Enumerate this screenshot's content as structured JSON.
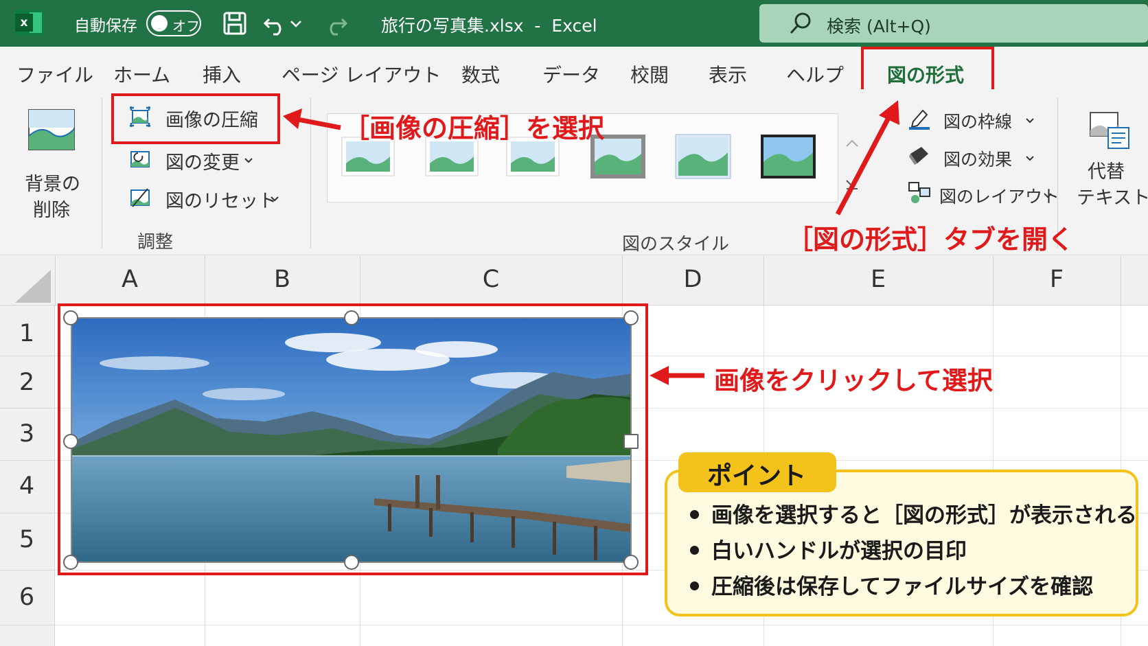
{
  "titlebar": {
    "autosave_label": "自動保存",
    "autosave_state": "オフ",
    "doc_title": "旅行の写真集.xlsx  -  Excel",
    "search_text": "検索 (Alt+Q)"
  },
  "tabs": [
    {
      "label": "ファイル"
    },
    {
      "label": "ホーム"
    },
    {
      "label": "挿入"
    },
    {
      "label": "ページ レイアウト"
    },
    {
      "label": "数式"
    },
    {
      "label": "データ"
    },
    {
      "label": "校閲"
    },
    {
      "label": "表示"
    },
    {
      "label": "ヘルプ"
    },
    {
      "label": "図の形式",
      "active": true
    }
  ],
  "ribbon": {
    "remove_bg_line1": "背景の",
    "remove_bg_line2": "削除",
    "compress": "画像の圧縮",
    "change": "図の変更",
    "reset": "図のリセット",
    "adjust_group": "調整",
    "styles_group": "図のスタイル",
    "border": "図の枠線",
    "effects": "図の効果",
    "layout": "図のレイアウト",
    "alt_line1": "代替",
    "alt_line2": "テキスト"
  },
  "annotations": {
    "compress_note": "［画像の圧縮］を選択",
    "tab_note": "［図の形式］タブを開く",
    "click_note": "画像をクリックして選択",
    "accent_color": "#e01a1a"
  },
  "sheet": {
    "columns": [
      "A",
      "B",
      "C",
      "D",
      "E",
      "F"
    ],
    "rows": [
      "1",
      "2",
      "3",
      "4",
      "5",
      "6"
    ]
  },
  "point": {
    "title": "ポイント",
    "bullets": [
      "画像を選択すると［図の形式］が表示される",
      "白いハンドルが選択の目印",
      "圧縮後は保存してファイルサイズを確認"
    ]
  }
}
